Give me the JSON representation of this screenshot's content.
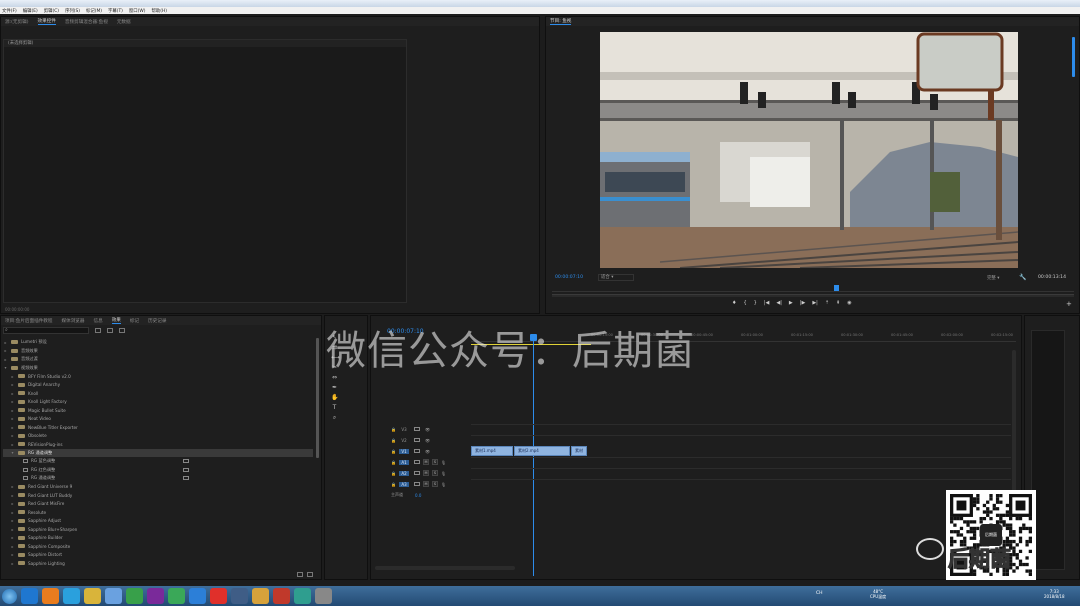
{
  "menu": [
    "文件(F)",
    "编辑(E)",
    "剪辑(C)",
    "序列(S)",
    "标记(M)",
    "字幕(T)",
    "窗口(W)",
    "帮助(H)"
  ],
  "source_tabs": [
    "源:(无剪辑)",
    "效果控件",
    "音频剪辑混合器:鱼视",
    "元数据"
  ],
  "source_placeholder": "(未选择剪辑)",
  "source_timecode": "00:00:00:00",
  "program": {
    "title": "节目: 鱼视",
    "timecode": "00:00:07:10",
    "fit_label": "适合",
    "quality": "完整",
    "duration": "00:00:13:14"
  },
  "effects_tabs": [
    "项目:鱼片后面插件教程",
    "媒体浏览器",
    "信息",
    "效果",
    "标记",
    "历史记录"
  ],
  "effects_tree": [
    {
      "label": "Lumetri 预设",
      "level": 0,
      "type": "folder"
    },
    {
      "label": "音频效果",
      "level": 0,
      "type": "folder"
    },
    {
      "label": "音频过渡",
      "level": 0,
      "type": "folder"
    },
    {
      "label": "视频效果",
      "level": 0,
      "type": "folder",
      "open": true
    },
    {
      "label": "BFY Film Studio v2.0",
      "level": 1,
      "type": "folder"
    },
    {
      "label": "Digital Anarchy",
      "level": 1,
      "type": "folder"
    },
    {
      "label": "Knoll",
      "level": 1,
      "type": "folder"
    },
    {
      "label": "Knoll Light Factory",
      "level": 1,
      "type": "folder"
    },
    {
      "label": "Magic Bullet Suite",
      "level": 1,
      "type": "folder"
    },
    {
      "label": "Neat Video",
      "level": 1,
      "type": "folder"
    },
    {
      "label": "NewBlue Titler Exporter",
      "level": 1,
      "type": "folder"
    },
    {
      "label": "Obsolete",
      "level": 1,
      "type": "folder"
    },
    {
      "label": "REVisionPlug-ins",
      "level": 1,
      "type": "folder"
    },
    {
      "label": "RG 通道调整",
      "level": 1,
      "type": "folder",
      "open": true,
      "selected": true
    },
    {
      "label": "RG 蓝色调整",
      "level": 2,
      "type": "fx"
    },
    {
      "label": "RG 红色调整",
      "level": 2,
      "type": "fx"
    },
    {
      "label": "RG 通道调整",
      "level": 2,
      "type": "fx"
    },
    {
      "label": "Red Giant Universe 9",
      "level": 1,
      "type": "folder"
    },
    {
      "label": "Red Giant LUT Buddy",
      "level": 1,
      "type": "folder"
    },
    {
      "label": "Red Giant MisFire",
      "level": 1,
      "type": "folder"
    },
    {
      "label": "Resolute",
      "level": 1,
      "type": "folder"
    },
    {
      "label": "Sapphire Adjust",
      "level": 1,
      "type": "folder"
    },
    {
      "label": "Sapphire Blur+Sharpen",
      "level": 1,
      "type": "folder"
    },
    {
      "label": "Sapphire Builder",
      "level": 1,
      "type": "folder"
    },
    {
      "label": "Sapphire Composite",
      "level": 1,
      "type": "folder"
    },
    {
      "label": "Sapphire Distort",
      "level": 1,
      "type": "folder"
    },
    {
      "label": "Sapphire Lighting",
      "level": 1,
      "type": "folder"
    }
  ],
  "timeline": {
    "timecode": "00:00:07:10",
    "ruler": [
      "00:00:15:00",
      "00:00:30:00",
      "00:00:45:00",
      "00:01:00:00",
      "00:01:15:00",
      "00:01:30:00",
      "00:01:45:00",
      "00:02:00:00",
      "00:02:15:00",
      "00:02:30:00"
    ],
    "video_tracks": [
      "V3",
      "V2",
      "V1"
    ],
    "audio_tracks": [
      "A1",
      "A2",
      "A3"
    ],
    "master_label": "主声道",
    "master_value": "0.0",
    "clips": [
      "素材1.mp4",
      "素材2.mp4",
      "素材"
    ],
    "track_buttons": [
      "M",
      "S"
    ]
  },
  "watermark": "微信公众号：后期菌",
  "qr_brand": "后期菌",
  "qr_center": "后期菌",
  "tray": {
    "temp": "48°C",
    "cpu": "CPU温度",
    "time": "7:33",
    "date": "2018/8/18",
    "lang": "CH"
  },
  "taskbar_apps": [
    "start",
    "ie",
    "photos",
    "ie2",
    "folder",
    "explorer",
    "network",
    "premiere",
    "360",
    "ps",
    "media",
    "chrome",
    "music",
    "tools",
    "app",
    "finder"
  ]
}
